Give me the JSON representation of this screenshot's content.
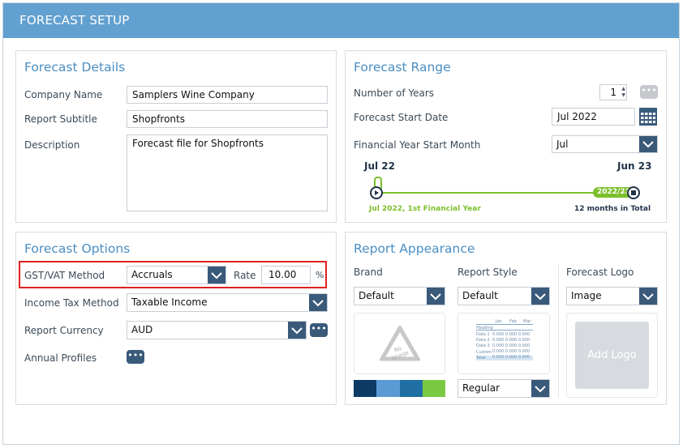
{
  "header": {
    "title": "FORECAST SETUP"
  },
  "details": {
    "title": "Forecast Details",
    "company_label": "Company Name",
    "company_value": "Samplers Wine Company",
    "subtitle_label": "Report Subtitle",
    "subtitle_value": "Shopfronts",
    "description_label": "Description",
    "description_value": "Forecast file for Shopfronts"
  },
  "range": {
    "title": "Forecast Range",
    "years_label": "Number of Years",
    "years_value": "1",
    "start_label": "Forecast Start Date",
    "start_value": "Jul 2022",
    "fy_label": "Financial Year Start Month",
    "fy_value": "Jul",
    "timeline": {
      "start_label": "Jul 22",
      "end_label": "Jun 23",
      "badge": "2022/23",
      "start_caption": "Jul 2022, 1st Financial Year",
      "end_caption": "12 months in Total"
    }
  },
  "options": {
    "title": "Forecast Options",
    "gst_label": "GST/VAT Method",
    "gst_value": "Accruals",
    "rate_label": "Rate",
    "rate_value": "10.00",
    "rate_unit": "%",
    "income_label": "Income Tax Method",
    "income_value": "Taxable Income",
    "currency_label": "Report Currency",
    "currency_value": "AUD",
    "profiles_label": "Annual Profiles"
  },
  "appearance": {
    "title": "Report Appearance",
    "brand_label": "Brand",
    "brand_value": "Default",
    "brand_placeholder": "No Image",
    "palette": [
      "#0d3b66",
      "#5b9bd5",
      "#1f6fa4",
      "#7ac943"
    ],
    "style_label": "Report Style",
    "style_value": "Default",
    "style_size": "Regular",
    "preview": {
      "months": [
        "Jan",
        "Feb",
        "Mar"
      ],
      "heading": "Heading",
      "rows": [
        "Data 1",
        "Data 2",
        "Data 3",
        "Custom",
        "Total"
      ],
      "cell": "0.000"
    },
    "logo_label": "Forecast Logo",
    "logo_value": "Image",
    "logo_button": "Add Logo"
  },
  "colors": {
    "header": "#62a0d0",
    "accent": "#4a8ec3",
    "arrow": "#3a5a7a",
    "highlight": "#e02020",
    "timeline": "#7cbf2c"
  }
}
